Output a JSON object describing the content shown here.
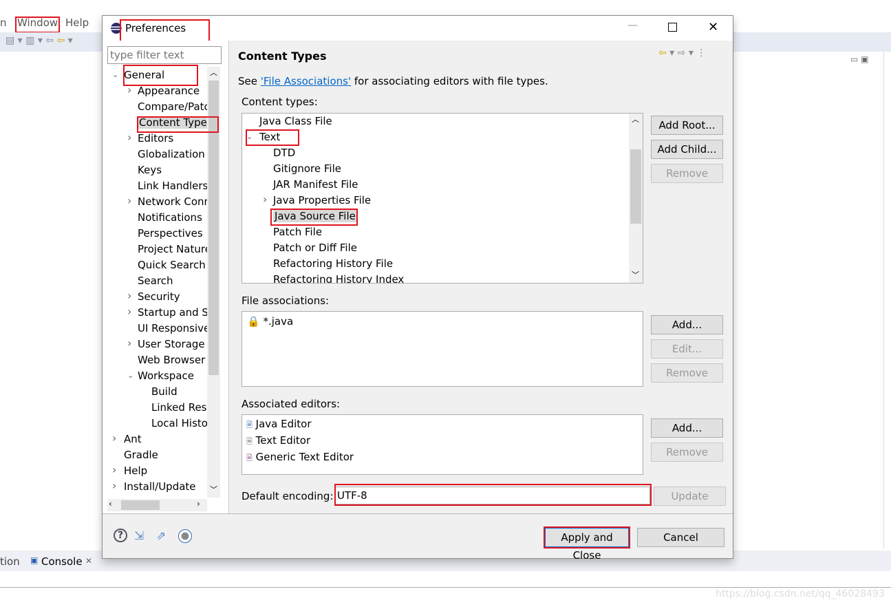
{
  "menubar": {
    "items": [
      "n",
      "Window",
      "Help"
    ]
  },
  "dialog": {
    "title": "Preferences",
    "filter_placeholder": "type filter text",
    "tree": [
      {
        "label": "General",
        "level": 0,
        "expanded": true
      },
      {
        "label": "Appearance",
        "level": 1,
        "expandable": true
      },
      {
        "label": "Compare/Patch",
        "level": 1
      },
      {
        "label": "Content Types",
        "level": 1,
        "selected": true
      },
      {
        "label": "Editors",
        "level": 1,
        "expandable": true
      },
      {
        "label": "Globalization",
        "level": 1
      },
      {
        "label": "Keys",
        "level": 1
      },
      {
        "label": "Link Handlers",
        "level": 1
      },
      {
        "label": "Network Connections",
        "level": 1,
        "expandable": true
      },
      {
        "label": "Notifications",
        "level": 1
      },
      {
        "label": "Perspectives",
        "level": 1
      },
      {
        "label": "Project Natures",
        "level": 1
      },
      {
        "label": "Quick Search",
        "level": 1
      },
      {
        "label": "Search",
        "level": 1
      },
      {
        "label": "Security",
        "level": 1,
        "expandable": true
      },
      {
        "label": "Startup and Shutdown",
        "level": 1,
        "expandable": true
      },
      {
        "label": "UI Responsiveness",
        "level": 1
      },
      {
        "label": "User Storage",
        "level": 1,
        "expandable": true
      },
      {
        "label": "Web Browser",
        "level": 1
      },
      {
        "label": "Workspace",
        "level": 1,
        "expanded": true
      },
      {
        "label": "Build",
        "level": 2
      },
      {
        "label": "Linked Resources",
        "level": 2
      },
      {
        "label": "Local History",
        "level": 2
      },
      {
        "label": "Ant",
        "level": 0,
        "expandable": true
      },
      {
        "label": "Gradle",
        "level": 0
      },
      {
        "label": "Help",
        "level": 0,
        "expandable": true
      },
      {
        "label": "Install/Update",
        "level": 0,
        "expandable": true
      }
    ],
    "page_title": "Content Types",
    "see_prefix": "See ",
    "see_link": "'File Associations'",
    "see_suffix": " for associating editors with file types.",
    "content_types_label": "Content types:",
    "content_types": [
      {
        "label": "Java Class File",
        "level": 1
      },
      {
        "label": "Text",
        "level": 1,
        "expanded": true
      },
      {
        "label": "DTD",
        "level": 2
      },
      {
        "label": "Gitignore File",
        "level": 2
      },
      {
        "label": "JAR Manifest File",
        "level": 2
      },
      {
        "label": "Java Properties File",
        "level": 2,
        "expandable": true
      },
      {
        "label": "Java Source File",
        "level": 2,
        "selected": true
      },
      {
        "label": "Patch File",
        "level": 2
      },
      {
        "label": "Patch or Diff File",
        "level": 2
      },
      {
        "label": "Refactoring History File",
        "level": 2
      },
      {
        "label": "Refactoring History Index",
        "level": 2
      }
    ],
    "ct_buttons": {
      "add_root": "Add Root...",
      "add_child": "Add Child...",
      "remove": "Remove"
    },
    "file_assoc_label": "File associations:",
    "file_assocs": [
      "*.java"
    ],
    "fa_buttons": {
      "add": "Add...",
      "edit": "Edit...",
      "remove": "Remove"
    },
    "assoc_editors_label": "Associated editors:",
    "editors": [
      "Java Editor",
      "Text Editor",
      "Generic Text Editor"
    ],
    "ed_buttons": {
      "add": "Add...",
      "remove": "Remove"
    },
    "encoding_label": "Default encoding:",
    "encoding_value": "UTF-8",
    "update": "Update",
    "apply_close": "Apply and Close",
    "cancel": "Cancel"
  },
  "console_tab": {
    "partial": "tion",
    "label": "Console"
  },
  "watermark": "https://blog.csdn.net/qq_46028493"
}
